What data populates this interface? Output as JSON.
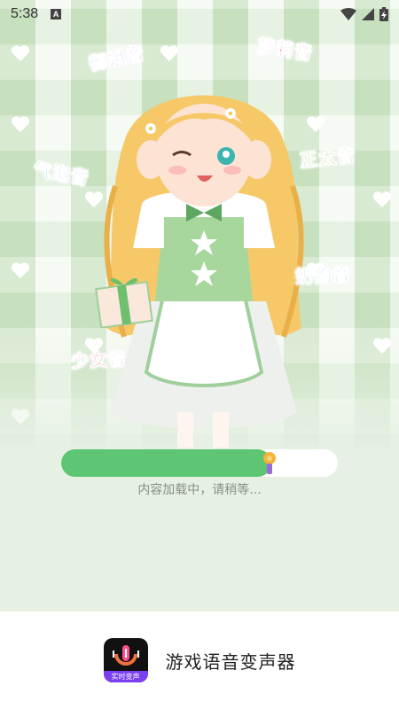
{
  "status_bar": {
    "time": "5:38",
    "notification_badge": "A",
    "icons": [
      "wifi-icon",
      "signal-icon",
      "battery-charging-icon"
    ]
  },
  "splash": {
    "voice_labels": [
      {
        "text": "御姐音",
        "color": "#a15de0"
      },
      {
        "text": "萝莉音",
        "color": "#e0478f"
      },
      {
        "text": "正太音",
        "color": "#8fb52c"
      },
      {
        "text": "气泡音",
        "color": "#39a2e0"
      },
      {
        "text": "奶狗音",
        "color": "#3aa8e0"
      },
      {
        "text": "少女音",
        "color": "#f06a8b"
      }
    ]
  },
  "loading": {
    "progress": 0.76,
    "text": "内容加载中，请稍等...",
    "fill_color": "#5ec672"
  },
  "footer": {
    "app_icon_tag": "实时变声",
    "app_name": "游戏语音变声器"
  }
}
